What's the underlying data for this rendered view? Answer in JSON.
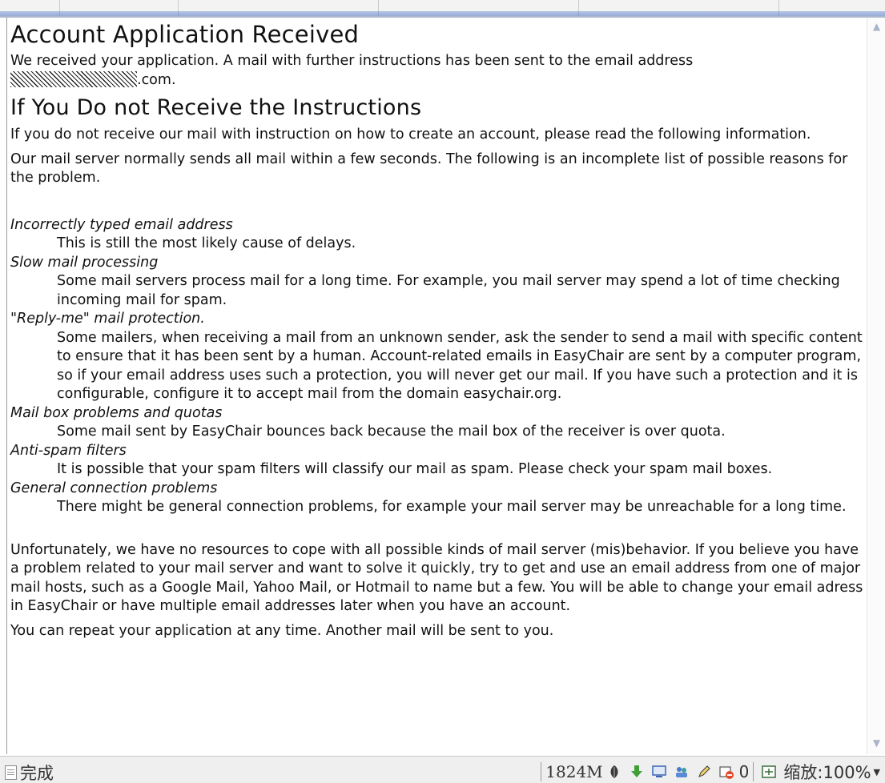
{
  "page": {
    "heading": "Account Application Received",
    "received_text": "We received your application. A mail with further instructions has been sent to the email address",
    "email_suffix": ".com.",
    "subheading": "If You Do not Receive the Instructions",
    "intro1": "If you do not receive our mail with instruction on how to create an account, please read the following information.",
    "intro2": "Our mail server normally sends all mail within a few seconds. The following is an incomplete list of possible reasons for the problem.",
    "reasons": [
      {
        "title": "Incorrectly typed email address",
        "text": "This is still the most likely cause of delays."
      },
      {
        "title": "Slow mail processing",
        "text": "Some mail servers process mail for a long time. For example, you mail server may spend a lot of time checking incoming mail for spam."
      },
      {
        "title": "\"Reply-me\" mail protection.",
        "text": "Some mailers, when receiving a mail from an unknown sender, ask the sender to send a mail with specific content to ensure that it has been sent by a human. Account-related emails in EasyChair are sent by a computer program, so if your email address uses such a protection, you will never get our mail. If you have such a protection and it is configurable, configure it to accept mail from the domain easychair.org."
      },
      {
        "title": "Mail box problems and quotas",
        "text": "Some mail sent by EasyChair bounces back because the mail box of the receiver is over quota."
      },
      {
        "title": "Anti-spam filters",
        "text": "It is possible that your spam filters will classify our mail as spam. Please check your spam mail boxes."
      },
      {
        "title": "General connection problems",
        "text": "There might be general connection problems, for example your mail server may be unreachable for a long time."
      }
    ],
    "unfortunately": "Unfortunately, we have no resources to cope with all possible kinds of mail server (mis)behavior. If you believe you have a problem related to your mail server and want to solve it quickly, try to get and use an email address from one of major mail hosts, such as a Google Mail, Yahoo Mail, or Hotmail to name but a few. You will be able to change your email adress in EasyChair or have multiple email addresses later when you have an account.",
    "repeat": "You can repeat your application at any time. Another mail will be sent to you."
  },
  "statusbar": {
    "status": "完成",
    "memory": "1824M",
    "count": "0",
    "zoom": "缩放:100%"
  },
  "colors": {
    "link_blue": "#4f74bf",
    "statusbar_bg": "#efefef"
  },
  "icons": [
    "page-icon",
    "leaf-icon",
    "download-arrow-icon",
    "monitor-icon",
    "users-icon",
    "edit-icon",
    "popup-block-icon",
    "zoom-icon",
    "scroll-up-icon",
    "scroll-down-icon"
  ]
}
